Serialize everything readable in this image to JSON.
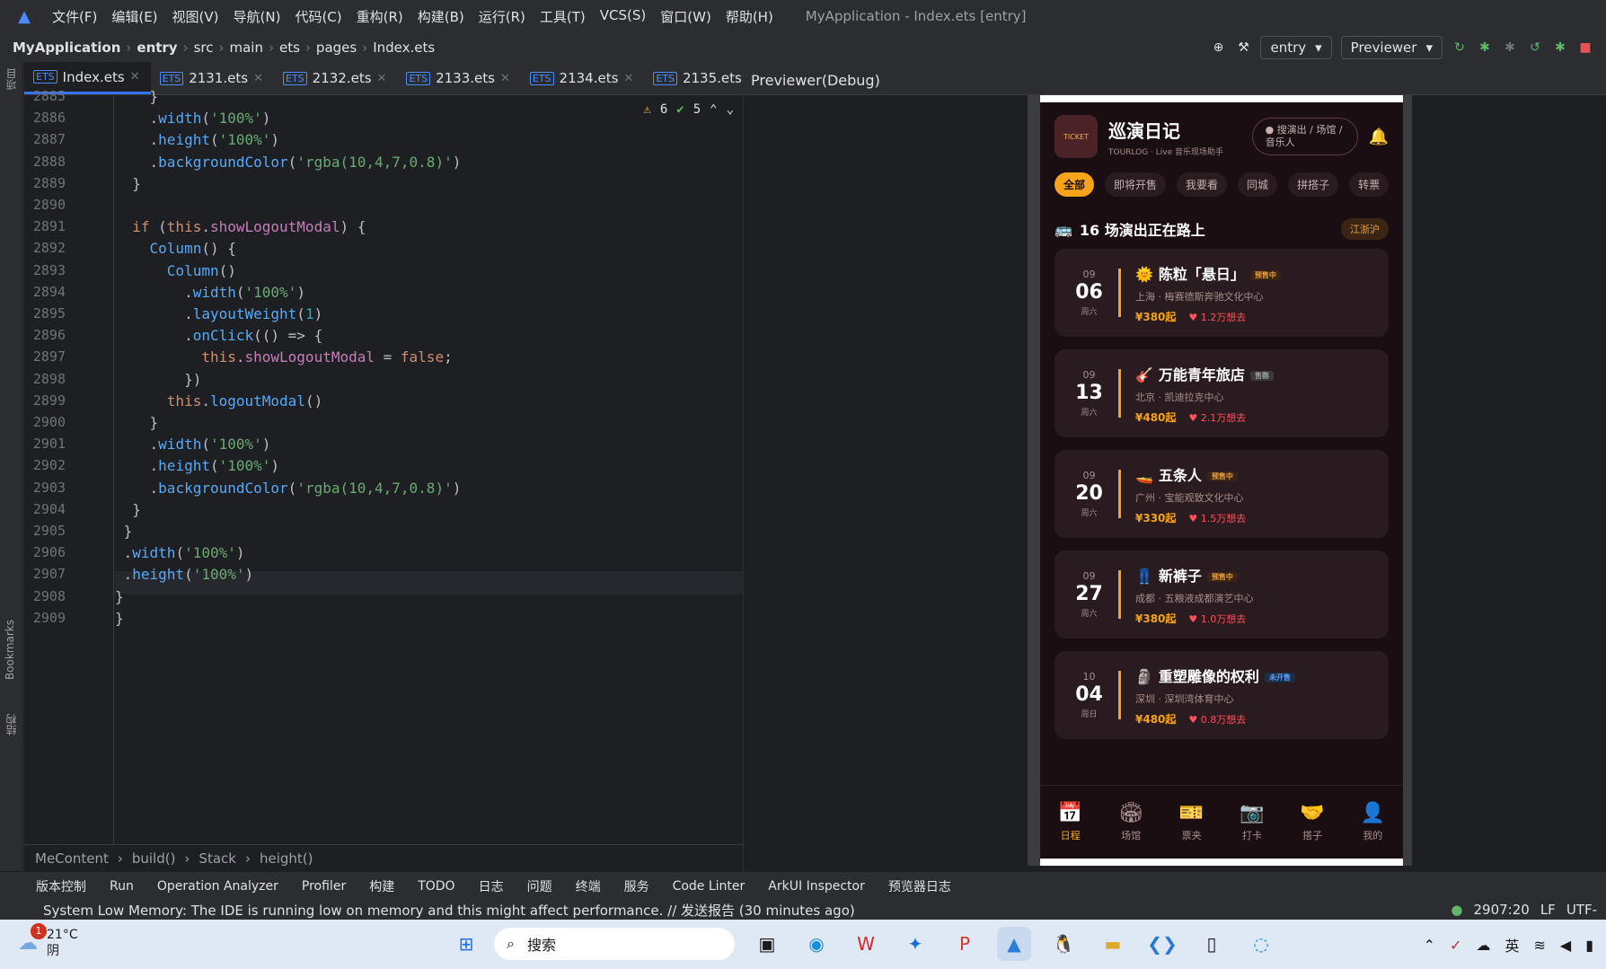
{
  "menubar": {
    "items": [
      "文件(F)",
      "编辑(E)",
      "视图(V)",
      "导航(N)",
      "代码(C)",
      "重构(R)",
      "构建(B)",
      "运行(R)",
      "工具(T)",
      "VCS(S)",
      "窗口(W)",
      "帮助(H)"
    ],
    "title": "MyApplication - Index.ets [entry]"
  },
  "navbar": {
    "crumbs": [
      "MyApplication",
      "entry",
      "src",
      "main",
      "ets",
      "pages",
      "Index.ets"
    ],
    "entry": "entry",
    "previewer": "Previewer"
  },
  "tabs": [
    "Index.ets",
    "2131.ets",
    "2132.ets",
    "2133.ets",
    "2134.ets",
    "2135.ets"
  ],
  "inspections": {
    "warnings": "6",
    "ok": "5"
  },
  "code": {
    "lines": [
      {
        "n": "2885",
        "t": "    }"
      },
      {
        "n": "2886",
        "t": "    .width('100%')"
      },
      {
        "n": "2887",
        "t": "    .height('100%')"
      },
      {
        "n": "2888",
        "t": "    .backgroundColor('rgba(10,4,7,0.8)')"
      },
      {
        "n": "2889",
        "t": "  }"
      },
      {
        "n": "2890",
        "t": ""
      },
      {
        "n": "2891",
        "t": "  if (this.showLogoutModal) {"
      },
      {
        "n": "2892",
        "t": "    Column() {"
      },
      {
        "n": "2893",
        "t": "      Column()"
      },
      {
        "n": "2894",
        "t": "        .width('100%')"
      },
      {
        "n": "2895",
        "t": "        .layoutWeight(1)"
      },
      {
        "n": "2896",
        "t": "        .onClick(() => {"
      },
      {
        "n": "2897",
        "t": "          this.showLogoutModal = false;"
      },
      {
        "n": "2898",
        "t": "        })"
      },
      {
        "n": "2899",
        "t": "      this.logoutModal()"
      },
      {
        "n": "2900",
        "t": "    }"
      },
      {
        "n": "2901",
        "t": "    .width('100%')"
      },
      {
        "n": "2902",
        "t": "    .height('100%')"
      },
      {
        "n": "2903",
        "t": "    .backgroundColor('rgba(10,4,7,0.8)')"
      },
      {
        "n": "2904",
        "t": "  }"
      },
      {
        "n": "2905",
        "t": " }"
      },
      {
        "n": "2906",
        "t": " .width('100%')"
      },
      {
        "n": "2907",
        "t": " .height('100%')"
      },
      {
        "n": "2908",
        "t": "}"
      },
      {
        "n": "2909",
        "t": "}"
      }
    ]
  },
  "crumbbar": [
    "MeContent",
    "build()",
    "Stack",
    "height()"
  ],
  "preview": {
    "header": "Previewer(Debug)",
    "app_title": "巡演日记",
    "app_sub": "TOURLOG · Live 音乐现场助手",
    "logo_text": "TICKET",
    "search": "搜演出 / 场馆 / 音乐人",
    "chips": [
      "全部",
      "即将开售",
      "我要看",
      "同城",
      "拼搭子",
      "转票"
    ],
    "section": "16 场演出正在路上",
    "region": "江浙沪",
    "events": [
      {
        "m": "09",
        "d": "06",
        "w": "周六",
        "name": "陈粒「悬日」",
        "badge": "预售中",
        "place": "上海 · 梅赛德斯奔驰文化中心",
        "price": "¥380起",
        "want": "1.2万想去",
        "icon": "🌞",
        "bt": "pre"
      },
      {
        "m": "09",
        "d": "13",
        "w": "周六",
        "name": "万能青年旅店",
        "badge": "售罄",
        "place": "北京 · 凯迪拉克中心",
        "price": "¥480起",
        "want": "2.1万想去",
        "icon": "🎸",
        "bt": "sold"
      },
      {
        "m": "09",
        "d": "20",
        "w": "周六",
        "name": "五条人",
        "badge": "预售中",
        "place": "广州 · 宝能观致文化中心",
        "price": "¥330起",
        "want": "1.5万想去",
        "icon": "🚤",
        "bt": "pre"
      },
      {
        "m": "09",
        "d": "27",
        "w": "周六",
        "name": "新裤子",
        "badge": "预售中",
        "place": "成都 · 五粮液成都演艺中心",
        "price": "¥380起",
        "want": "1.0万想去",
        "icon": "👖",
        "bt": "pre"
      },
      {
        "m": "10",
        "d": "04",
        "w": "周日",
        "name": "重塑雕像的权利",
        "badge": "未开售",
        "place": "深圳 · 深圳湾体育中心",
        "price": "¥480起",
        "want": "0.8万想去",
        "icon": "🗿",
        "bt": "not"
      }
    ],
    "tabbar": [
      {
        "icon": "📅",
        "label": "日程"
      },
      {
        "icon": "🏟",
        "label": "场馆"
      },
      {
        "icon": "🎫",
        "label": "票夹"
      },
      {
        "icon": "📷",
        "label": "打卡"
      },
      {
        "icon": "🤝",
        "label": "搭子"
      },
      {
        "icon": "👤",
        "label": "我的"
      }
    ]
  },
  "toolwindows": [
    "版本控制",
    "Run",
    "Operation Analyzer",
    "Profiler",
    "构建",
    "TODO",
    "日志",
    "问题",
    "终端",
    "服务",
    "Code Linter",
    "ArkUI Inspector",
    "预览器日志"
  ],
  "status": {
    "message": "System Low Memory: The IDE is running low on memory and this might affect performance. // 发送报告 (30 minutes ago)",
    "pos": "2907:20",
    "lf": "LF",
    "enc": "UTF-"
  },
  "taskbar": {
    "temp": "21°C",
    "weather": "阴",
    "search": "搜索",
    "badge": "1",
    "ime": "英"
  }
}
